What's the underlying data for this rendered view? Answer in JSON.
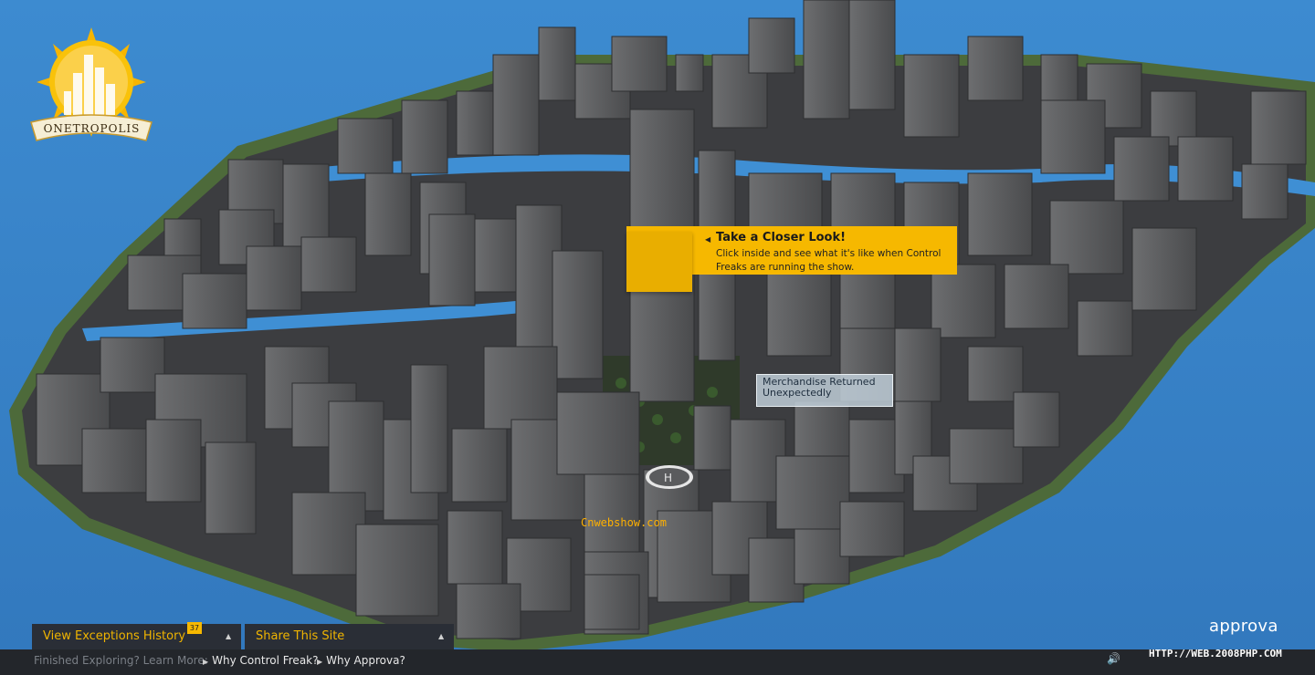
{
  "logo": {
    "name": "ONETROPOLIS"
  },
  "callout": {
    "title": "Take a Closer Look!",
    "body": "Click inside and see what it's like when Control Freaks are running the show."
  },
  "map_tag": {
    "label": "Merchandise Returned Unexpectedly"
  },
  "watermark": "Cnwebshow.com",
  "bottom_tabs": {
    "exceptions": {
      "label": "View Exceptions History",
      "badge": "37"
    },
    "share": {
      "label": "Share This Site"
    }
  },
  "statusbar": {
    "prompt": "Finished Exploring? Learn More:",
    "links": [
      "Why Control Freak?",
      "Why Approva?"
    ],
    "site_mark": "HTTP://WEB.2008PHP.COM"
  },
  "brand": "approva",
  "icons": [
    "sun-logo-icon",
    "speaker-icon",
    "callout-arrow-icon",
    "caret-up-icon"
  ],
  "colors": {
    "accent": "#f6b800",
    "water": "#3a86c8",
    "bar": "#23262b"
  }
}
